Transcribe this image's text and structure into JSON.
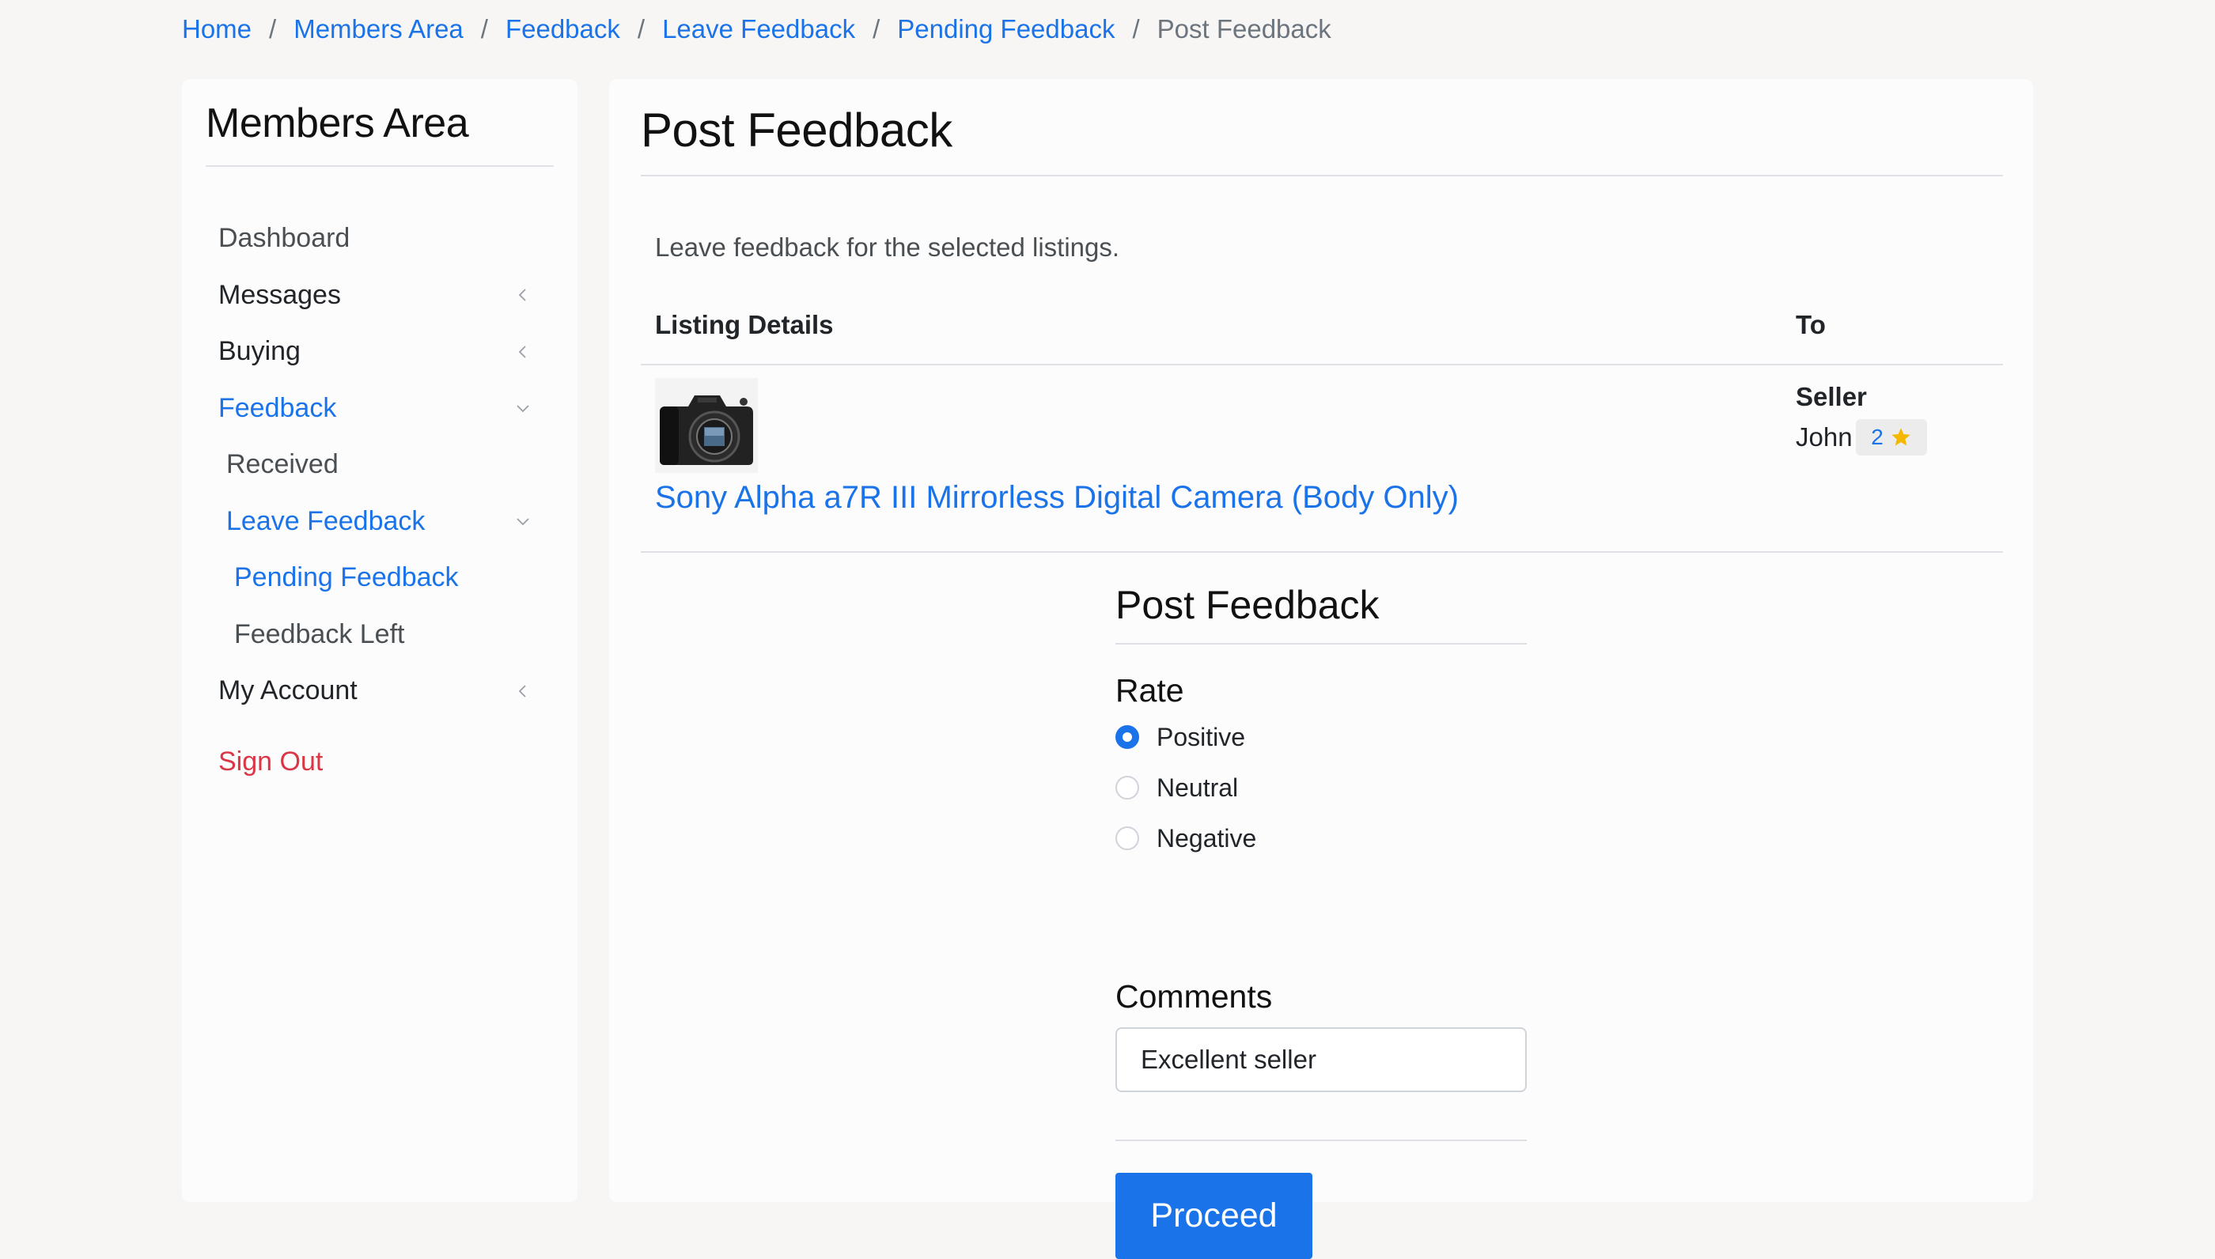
{
  "breadcrumb": {
    "items": [
      "Home",
      "Members Area",
      "Feedback",
      "Leave Feedback",
      "Pending Feedback"
    ],
    "current": "Post Feedback",
    "separator": "/"
  },
  "sidebar": {
    "title": "Members Area",
    "items": [
      {
        "label": "Dashboard",
        "icon": "none"
      },
      {
        "label": "Messages",
        "icon": "chevron-left-icon"
      },
      {
        "label": "Buying",
        "icon": "chevron-left-icon"
      },
      {
        "label": "Feedback",
        "icon": "chevron-down-icon",
        "state": "active"
      },
      {
        "label": "Received",
        "icon": "none"
      },
      {
        "label": "Leave Feedback",
        "icon": "chevron-down-icon",
        "state": "active"
      },
      {
        "label": "Pending Feedback",
        "icon": "none",
        "state": "active"
      },
      {
        "label": "Feedback Left",
        "icon": "none"
      },
      {
        "label": "My Account",
        "icon": "chevron-left-icon"
      }
    ],
    "sign_out": "Sign Out"
  },
  "main": {
    "title": "Post Feedback",
    "intro": "Leave feedback for the selected listings.",
    "table": {
      "headers": [
        "Listing Details",
        "To"
      ],
      "row": {
        "listing_title": "Sony Alpha a7R III Mirrorless Digital Camera (Body Only)",
        "image_icon": "camera-icon",
        "to_role": "Seller",
        "to_name": "John",
        "rating_count": "2",
        "rating_icon": "star-icon"
      }
    }
  },
  "form": {
    "title": "Post Feedback",
    "rate_label": "Rate",
    "options": [
      "Positive",
      "Neutral",
      "Negative"
    ],
    "selected": "Positive",
    "comments_label": "Comments",
    "comments_value": "Excellent seller",
    "submit_label": "Proceed"
  },
  "colors": {
    "accent": "#1a73e8",
    "danger": "#dc3545",
    "star": "#f5b800",
    "background": "#f7f6f5",
    "card": "#fcfcfc"
  }
}
